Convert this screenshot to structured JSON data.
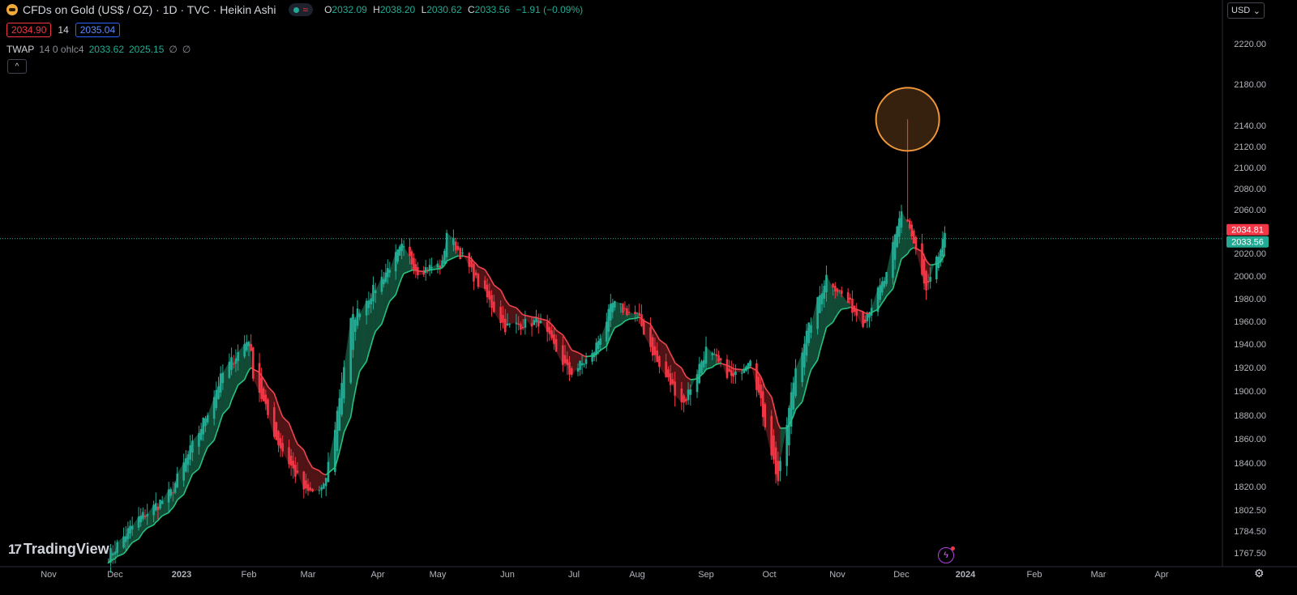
{
  "header": {
    "title": "CFDs on Gold (US$ / OZ) · 1D · TVC · Heikin Ashi",
    "ohlc": {
      "o_label": "O",
      "o": "2032.09",
      "h_label": "H",
      "h": "2038.20",
      "l_label": "L",
      "l": "2030.62",
      "c_label": "C",
      "c": "2033.56",
      "change": "−1.91 (−0.09%)"
    },
    "sell_price": "2034.90",
    "spread": "14",
    "buy_price": "2035.04"
  },
  "indicator": {
    "name": "TWAP",
    "params": "14 0 ohlc4",
    "value1": "2033.62",
    "value2": "2025.15",
    "icon1": "∅",
    "icon2": "∅"
  },
  "currency": "USD",
  "brand": "TradingView",
  "colors": {
    "up": "#22ab94",
    "down": "#f23645",
    "twap_up": "#26c281",
    "twap_down": "#f0454e",
    "highlight": "#f0963b",
    "price_line": "#22ab94"
  },
  "chart_data": {
    "type": "candlestick",
    "y_ticks": [
      "2220.00",
      "2180.00",
      "2140.00",
      "2120.00",
      "2100.00",
      "2080.00",
      "2060.00",
      "2020.00",
      "2000.00",
      "1980.00",
      "1960.00",
      "1940.00",
      "1920.00",
      "1900.00",
      "1880.00",
      "1860.00",
      "1840.00",
      "1820.00",
      "1802.50",
      "1784.50",
      "1767.50"
    ],
    "x_ticks": [
      "Nov",
      "Dec",
      "2023",
      "Feb",
      "Mar",
      "Apr",
      "May",
      "Jun",
      "Jul",
      "Aug",
      "Sep",
      "Oct",
      "Nov",
      "Dec",
      "2024",
      "Feb",
      "Mar",
      "Apr"
    ],
    "last_price_labels": {
      "red": "2034.81",
      "green": "2033.56"
    },
    "current_price": 2033.56,
    "highlight_circle": {
      "around": "Dec spike high",
      "price": 2146
    },
    "series": [
      {
        "name": "Heikin Ashi",
        "waypoints": [
          [
            "2022-11-28",
            1765
          ],
          [
            "2022-12-12",
            1795
          ],
          [
            "2022-12-27",
            1815
          ],
          [
            "2023-01-10",
            1870
          ],
          [
            "2023-01-20",
            1915
          ],
          [
            "2023-02-01",
            1945
          ],
          [
            "2023-02-03",
            1915
          ],
          [
            "2023-02-14",
            1860
          ],
          [
            "2023-02-28",
            1815
          ],
          [
            "2023-03-08",
            1818
          ],
          [
            "2023-03-13",
            1870
          ],
          [
            "2023-03-20",
            1960
          ],
          [
            "2023-03-31",
            1990
          ],
          [
            "2023-04-13",
            2025
          ],
          [
            "2023-04-21",
            2005
          ],
          [
            "2023-05-03",
            2010
          ],
          [
            "2023-05-05",
            2040
          ],
          [
            "2023-05-17",
            2000
          ],
          [
            "2023-05-31",
            1955
          ],
          [
            "2023-06-15",
            1960
          ],
          [
            "2023-06-29",
            1915
          ],
          [
            "2023-07-10",
            1930
          ],
          [
            "2023-07-20",
            1975
          ],
          [
            "2023-08-01",
            1965
          ],
          [
            "2023-08-11",
            1920
          ],
          [
            "2023-08-22",
            1890
          ],
          [
            "2023-09-01",
            1935
          ],
          [
            "2023-09-14",
            1910
          ],
          [
            "2023-09-22",
            1930
          ],
          [
            "2023-10-05",
            1825
          ],
          [
            "2023-10-13",
            1920
          ],
          [
            "2023-10-27",
            2000
          ],
          [
            "2023-11-13",
            1960
          ],
          [
            "2023-11-24",
            2000
          ],
          [
            "2023-12-01",
            2060
          ],
          [
            "2023-12-04",
            2050
          ],
          [
            "2023-12-13",
            1985
          ],
          [
            "2023-12-22",
            2034
          ]
        ],
        "special_wick": {
          "date": "2023-12-04",
          "high": 2146
        }
      },
      {
        "name": "TWAP",
        "values_note": ""
      }
    ]
  }
}
